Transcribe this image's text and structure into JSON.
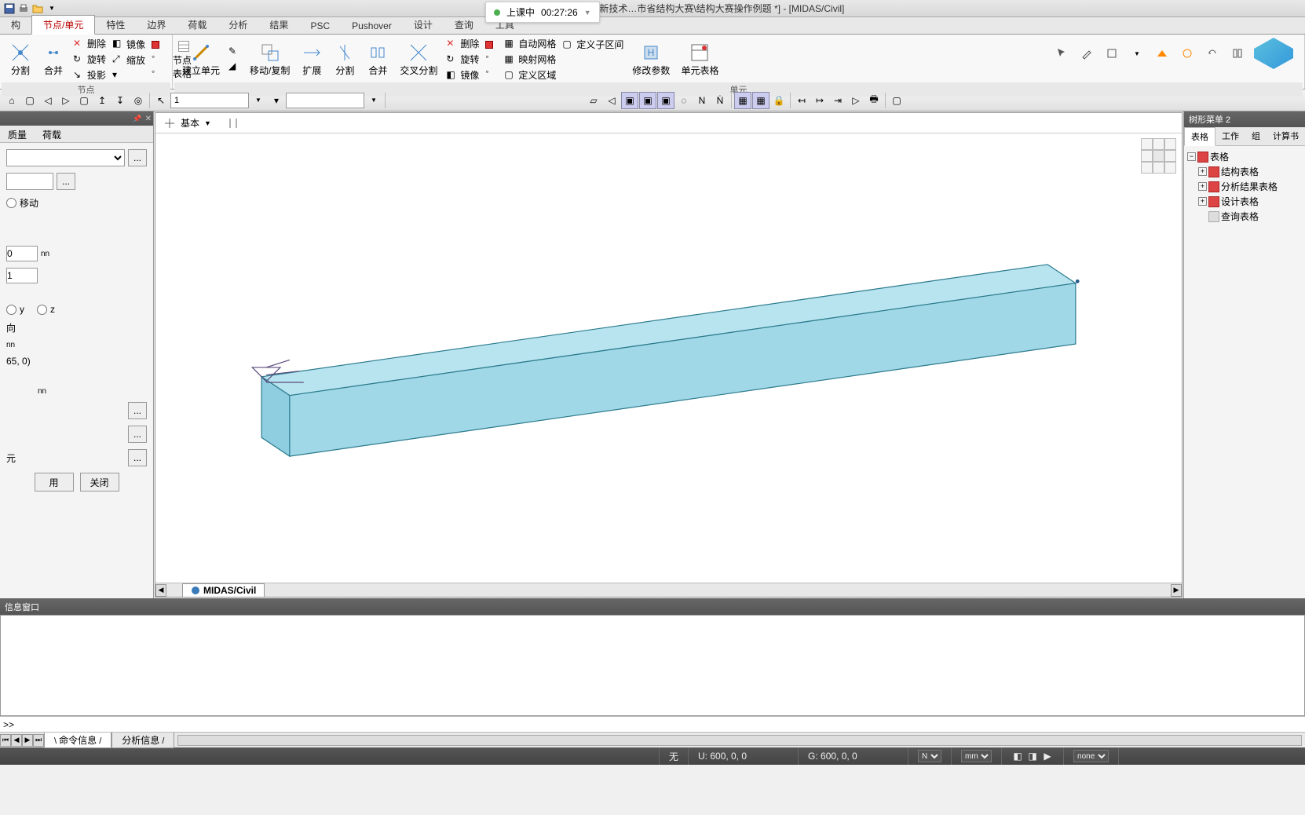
{
  "title": "Civil 2020 - [E:\\03-新技术…市省结构大赛\\结构大赛操作例题 *] - [MIDAS/Civil]",
  "rec": {
    "status": "上课中",
    "time": "00:27:26"
  },
  "ribbon_tabs": [
    "构",
    "节点/单元",
    "特性",
    "边界",
    "荷载",
    "分析",
    "结果",
    "PSC",
    "Pushover",
    "设计",
    "查询",
    "工具"
  ],
  "ribbon_active": 1,
  "groups": {
    "g1": {
      "label": "节点",
      "btns": {
        "a": "分割",
        "b": "合并",
        "c": "投影",
        "d": "删除",
        "e": "旋转",
        "f": "缩放",
        "g": "镜像",
        "h": "节点表格"
      }
    },
    "g2": {
      "label": "单元",
      "btns": {
        "a": "建立单元",
        "b": "移动/复制",
        "c": "扩展",
        "d": "分割",
        "e": "合并",
        "f": "交叉分割",
        "g": "镜像",
        "h": "旋转",
        "i": "修改参数",
        "j": "单元表格",
        "k": "删除",
        "l": "自动网格",
        "m": "映射网格",
        "n": "定义区域",
        "o": "定义子区间"
      }
    }
  },
  "toolbar_input": "1",
  "left": {
    "tabs": [
      "质量",
      "荷载"
    ],
    "radio_move": "移动",
    "num0": "0",
    "num1": "1",
    "unit_nn": "nn",
    "y": "y",
    "z": "z",
    "dir": "向",
    "coord": "65, 0)",
    "unit": "元",
    "apply": "用",
    "close": "关闭"
  },
  "viewport": {
    "base": "基本",
    "doctab": "MIDAS/Civil"
  },
  "right": {
    "title": "树形菜单 2",
    "tabs": [
      "表格",
      "工作",
      "组",
      "计算书"
    ],
    "tree": [
      "表格",
      "结构表格",
      "分析结果表格",
      "设计表格",
      "查询表格"
    ]
  },
  "msg": {
    "title": "信息窗口",
    "prompt": ">>",
    "tabs": [
      "命令信息",
      "分析信息"
    ]
  },
  "status": {
    "none": "无",
    "u": "U: 600, 0, 0",
    "g": "G: 600, 0, 0",
    "n": "N",
    "mm": "mm",
    "none2": "none"
  }
}
